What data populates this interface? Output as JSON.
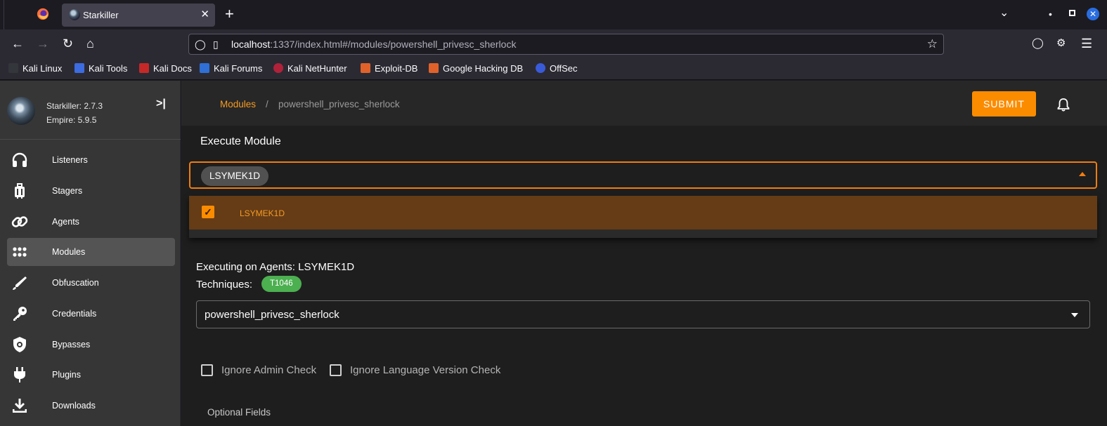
{
  "browser": {
    "tab_title": "Starkiller",
    "tab_close": "✕",
    "new_tab": "+",
    "url_host": "localhost",
    "url_rest": ":1337/index.html#/modules/powershell_privesc_sherlock",
    "bookmarks": [
      "Kali Linux",
      "Kali Tools",
      "Kali Docs",
      "Kali Forums",
      "Kali NetHunter",
      "Exploit-DB",
      "Google Hacking DB",
      "OffSec"
    ]
  },
  "sidebar": {
    "version": "Starkiller: 2.7.3",
    "empire": "Empire: 5.9.5",
    "collapse_icon": ">|",
    "items": [
      {
        "label": "Listeners",
        "icon": "headphones-icon"
      },
      {
        "label": "Stagers",
        "icon": "luggage-icon"
      },
      {
        "label": "Agents",
        "icon": "link-icon"
      },
      {
        "label": "Modules",
        "icon": "apps-grid-icon"
      },
      {
        "label": "Obfuscation",
        "icon": "brush-icon"
      },
      {
        "label": "Credentials",
        "icon": "key-icon"
      },
      {
        "label": "Bypasses",
        "icon": "shield-icon"
      },
      {
        "label": "Plugins",
        "icon": "plug-icon"
      },
      {
        "label": "Downloads",
        "icon": "download-icon"
      }
    ]
  },
  "header": {
    "breadcrumb_modules": "Modules",
    "breadcrumb_sep": "/",
    "breadcrumb_current": "powershell_privesc_sherlock",
    "submit_label": "SUBMIT"
  },
  "card": {
    "title": "Execute Module",
    "selected_agent": "LSYMEK1D",
    "agent_option": "LSYMEK1D",
    "executing_text": "Executing on Agents: LSYMEK1D",
    "techniques_label": "Techniques:",
    "technique": "T1046",
    "module_value": "powershell_privesc_sherlock",
    "checkbox_admin": "Ignore Admin Check",
    "checkbox_language": "Ignore Language Version Check",
    "optional_fields": "Optional Fields"
  },
  "colors": {
    "accent": "#fb8c00",
    "technique_chip": "#4caf50",
    "selected_option_bg": "#653c16"
  }
}
